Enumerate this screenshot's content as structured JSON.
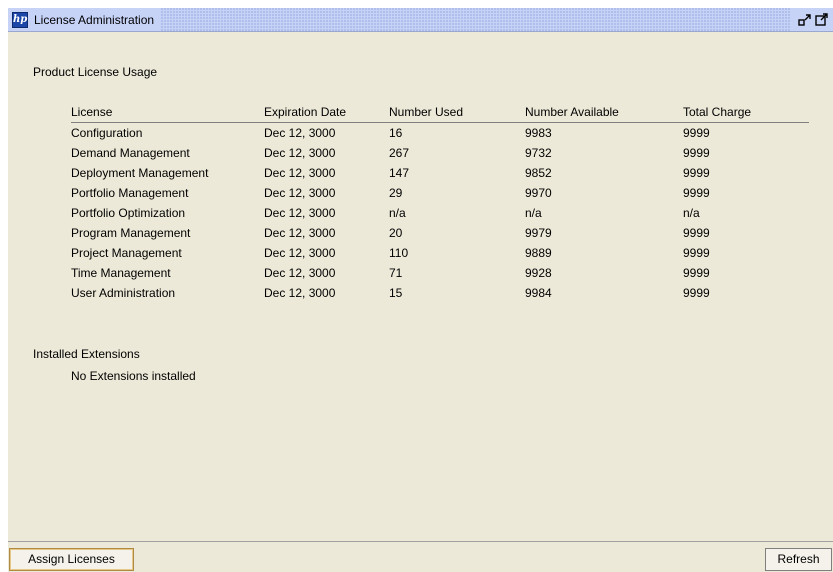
{
  "window": {
    "title": "License Administration",
    "logo_text": "hp"
  },
  "usage": {
    "section_title": "Product License Usage",
    "columns": [
      "License",
      "Expiration Date",
      "Number Used",
      "Number Available",
      "Total Charge"
    ],
    "rows": [
      [
        "Configuration",
        "Dec 12, 3000",
        "16",
        "9983",
        "9999"
      ],
      [
        "Demand Management",
        "Dec 12, 3000",
        "267",
        "9732",
        "9999"
      ],
      [
        "Deployment Management",
        "Dec 12, 3000",
        "147",
        "9852",
        "9999"
      ],
      [
        "Portfolio Management",
        "Dec 12, 3000",
        "29",
        "9970",
        "9999"
      ],
      [
        "Portfolio Optimization",
        "Dec 12, 3000",
        "n/a",
        "n/a",
        "n/a"
      ],
      [
        "Program Management",
        "Dec 12, 3000",
        "20",
        "9979",
        "9999"
      ],
      [
        "Project Management",
        "Dec 12, 3000",
        "110",
        "9889",
        "9999"
      ],
      [
        "Time Management",
        "Dec 12, 3000",
        "71",
        "9928",
        "9999"
      ],
      [
        "User Administration",
        "Dec 12, 3000",
        "15",
        "9984",
        "9999"
      ]
    ]
  },
  "extensions": {
    "section_title": "Installed Extensions",
    "empty_text": "No Extensions installed"
  },
  "buttons": {
    "assign_label": "Assign Licenses",
    "refresh_label": "Refresh"
  },
  "colors": {
    "panel_bg": "#ece9d8",
    "titlebar_bg": "#c6d3f7"
  }
}
